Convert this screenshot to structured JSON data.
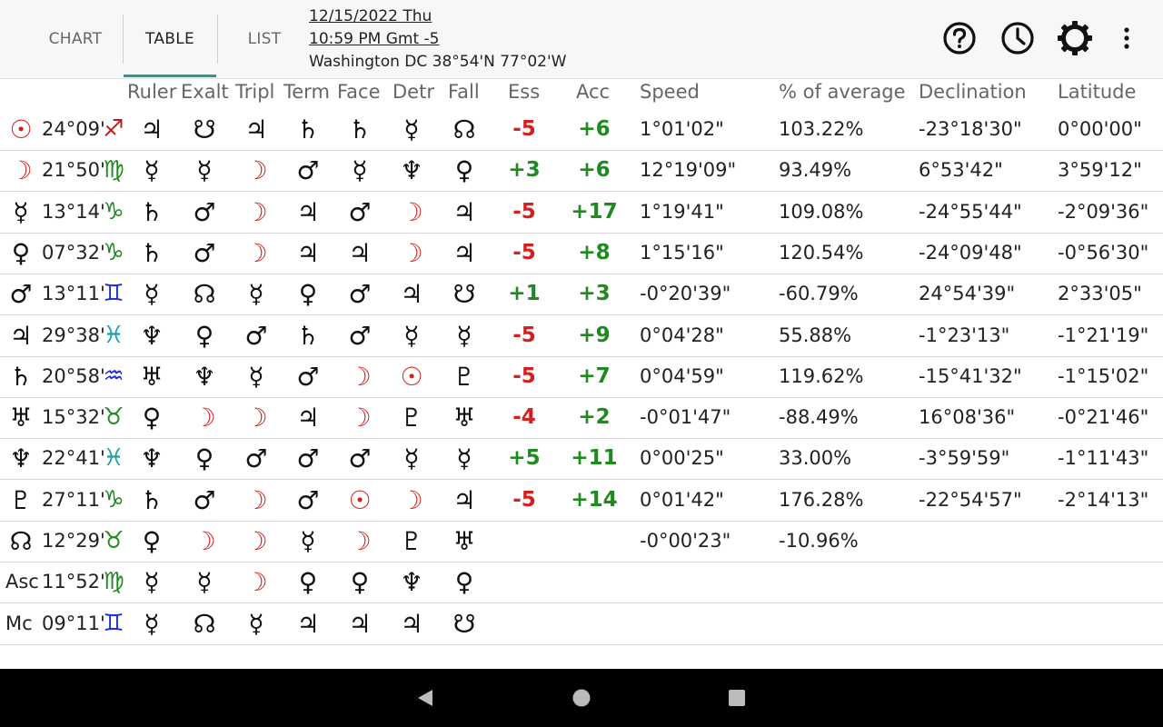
{
  "tabs": [
    {
      "label": "CHART",
      "active": false
    },
    {
      "label": "TABLE",
      "active": true
    },
    {
      "label": "LIST",
      "active": false
    }
  ],
  "info": {
    "date": "12/15/2022 Thu",
    "time": "10:59 PM Gmt -5",
    "location": "Washington DC 38°54'N 77°02'W"
  },
  "icons": [
    "help-circle-icon",
    "clock-icon",
    "gear-icon",
    "more-vert-icon"
  ],
  "headers": [
    "Ruler",
    "Exalt",
    "Tripl",
    "Term",
    "Face",
    "Detr",
    "Fall",
    "Ess",
    "Acc",
    "Speed",
    "% of average",
    "Declination",
    "Latitude"
  ],
  "colors": {
    "red": "#d32020",
    "green": "#1f8a1f",
    "fire": "#c01818",
    "earth": "#1f8a1f",
    "air": "#1a2fd8",
    "water": "#17a0a8"
  },
  "rows": [
    {
      "body": "☉",
      "deg": "24°09'",
      "sign": "♐",
      "dign": [
        "♃",
        "☋",
        "♃",
        "♄",
        "♄",
        "☿",
        "☊"
      ],
      "ess": "-5",
      "acc": "+6",
      "speed": "1°01'02\"",
      "pct": "103.22%",
      "decl": "-23°18'30\"",
      "lat": "0°00'00\""
    },
    {
      "body": "☽",
      "deg": "21°50'",
      "sign": "♍",
      "dign": [
        "☿",
        "☿",
        "☽",
        "♂",
        "☿",
        "♆",
        "♀"
      ],
      "ess": "+3",
      "acc": "+6",
      "speed": "12°19'09\"",
      "pct": "93.49%",
      "decl": "6°53'42\"",
      "lat": "3°59'12\""
    },
    {
      "body": "☿",
      "deg": "13°14'",
      "sign": "♑",
      "dign": [
        "♄",
        "♂",
        "☽",
        "♃",
        "♂",
        "☽",
        "♃"
      ],
      "ess": "-5",
      "acc": "+17",
      "speed": "1°19'41\"",
      "pct": "109.08%",
      "decl": "-24°55'44\"",
      "lat": "-2°09'36\""
    },
    {
      "body": "♀",
      "deg": "07°32'",
      "sign": "♑",
      "dign": [
        "♄",
        "♂",
        "☽",
        "♃",
        "♃",
        "☽",
        "♃"
      ],
      "ess": "-5",
      "acc": "+8",
      "speed": "1°15'16\"",
      "pct": "120.54%",
      "decl": "-24°09'48\"",
      "lat": "-0°56'30\""
    },
    {
      "body": "♂",
      "deg": "13°11'",
      "sign": "♊",
      "dign": [
        "☿",
        "☊",
        "☿",
        "♀",
        "♂",
        "♃",
        "☋"
      ],
      "ess": "+1",
      "acc": "+3",
      "speed": "-0°20'39\"",
      "pct": "-60.79%",
      "decl": "24°54'39\"",
      "lat": "2°33'05\""
    },
    {
      "body": "♃",
      "deg": "29°38'",
      "sign": "♓",
      "dign": [
        "♆",
        "♀",
        "♂",
        "♄",
        "♂",
        "☿",
        "☿"
      ],
      "ess": "-5",
      "acc": "+9",
      "speed": "0°04'28\"",
      "pct": "55.88%",
      "decl": "-1°23'13\"",
      "lat": "-1°21'19\""
    },
    {
      "body": "♄",
      "deg": "20°58'",
      "sign": "♒",
      "dign": [
        "♅",
        "♆",
        "☿",
        "♂",
        "☽",
        "☉",
        "♇"
      ],
      "ess": "-5",
      "acc": "+7",
      "speed": "0°04'59\"",
      "pct": "119.62%",
      "decl": "-15°41'32\"",
      "lat": "-1°15'02\""
    },
    {
      "body": "♅",
      "deg": "15°32'",
      "sign": "♉",
      "dign": [
        "♀",
        "☽",
        "☽",
        "♃",
        "☽",
        "♇",
        "♅"
      ],
      "ess": "-4",
      "acc": "+2",
      "speed": "-0°01'47\"",
      "pct": "-88.49%",
      "decl": "16°08'36\"",
      "lat": "-0°21'46\""
    },
    {
      "body": "♆",
      "deg": "22°41'",
      "sign": "♓",
      "dign": [
        "♆",
        "♀",
        "♂",
        "♂",
        "♂",
        "☿",
        "☿"
      ],
      "ess": "+5",
      "acc": "+11",
      "speed": "0°00'25\"",
      "pct": "33.00%",
      "decl": "-3°59'59\"",
      "lat": "-1°11'43\""
    },
    {
      "body": "♇",
      "deg": "27°11'",
      "sign": "♑",
      "dign": [
        "♄",
        "♂",
        "☽",
        "♂",
        "☉",
        "☽",
        "♃"
      ],
      "ess": "-5",
      "acc": "+14",
      "speed": "0°01'42\"",
      "pct": "176.28%",
      "decl": "-22°54'57\"",
      "lat": "-2°14'13\""
    },
    {
      "body": "☊",
      "deg": "12°29'",
      "sign": "♉",
      "dign": [
        "♀",
        "☽",
        "☽",
        "☿",
        "☽",
        "♇",
        "♅"
      ],
      "ess": "",
      "acc": "",
      "speed": "-0°00'23\"",
      "pct": "-10.96%",
      "decl": "",
      "lat": ""
    },
    {
      "body": "Asc",
      "deg": "11°52'",
      "sign": "♍",
      "dign": [
        "☿",
        "☿",
        "☽",
        "♀",
        "♀",
        "♆",
        "♀"
      ],
      "ess": "",
      "acc": "",
      "speed": "",
      "pct": "",
      "decl": "",
      "lat": ""
    },
    {
      "body": "Mc",
      "deg": "09°11'",
      "sign": "♊",
      "dign": [
        "☿",
        "☊",
        "☿",
        "♃",
        "♃",
        "♃",
        "☋"
      ],
      "ess": "",
      "acc": "",
      "speed": "",
      "pct": "",
      "decl": "",
      "lat": ""
    }
  ],
  "nav": [
    "back-icon",
    "home-icon",
    "recents-icon"
  ]
}
